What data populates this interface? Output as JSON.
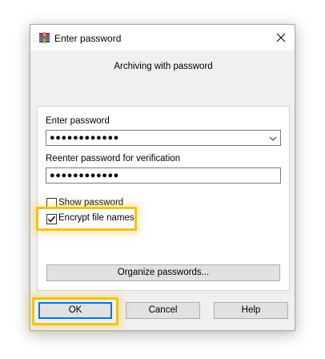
{
  "background_ghost": {
    "line1": "",
    "line2": ""
  },
  "dialog": {
    "title": "Enter password",
    "subtitle": "Archiving with password",
    "password": {
      "label": "Enter password",
      "value": "●●●●●●●●●●●●"
    },
    "reenter": {
      "label": "Reenter password for verification",
      "value": "●●●●●●●●●●●●"
    },
    "show_password": {
      "label": "Show password",
      "checked": false
    },
    "encrypt_names": {
      "label": "Encrypt file names",
      "checked": true
    },
    "organize_label": "Organize passwords...",
    "buttons": {
      "ok": "OK",
      "cancel": "Cancel",
      "help": "Help"
    }
  },
  "colors": {
    "highlight": "#f0c419",
    "focus": "#0078d7",
    "dialog_bg": "#f0f0f0"
  }
}
